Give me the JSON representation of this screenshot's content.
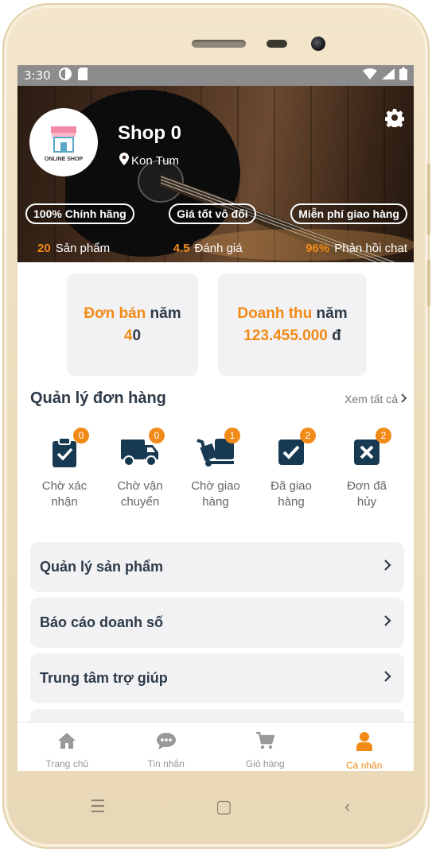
{
  "status_bar": {
    "time": "3:30"
  },
  "shop": {
    "name": "Shop 0",
    "location": "Kon Tum",
    "logo_text": "ONLINE SHOP",
    "badges": [
      "100% Chính hãng",
      "Giá tốt vô đối",
      "Miễn phí giao hàng"
    ],
    "stats": [
      {
        "value": "20",
        "label": "Sản phẩm"
      },
      {
        "value": "4.5",
        "label": "Đánh giá"
      },
      {
        "value": "96%",
        "label": "Phản hồi chat"
      }
    ]
  },
  "summary": {
    "orders_year": {
      "title_accent": "Đơn bán",
      "title_rest": " năm",
      "value_accent": "4",
      "value_rest": "0"
    },
    "revenue_year": {
      "title_accent": "Doanh thu",
      "title_rest": " năm",
      "value_accent": "123.455.000",
      "value_rest": " đ"
    }
  },
  "order_management": {
    "title": "Quản lý đơn hàng",
    "see_all": "Xem tất cả",
    "items": [
      {
        "label_1": "Chờ xác",
        "label_2": "nhận",
        "count": "0",
        "icon": "clipboard-check-icon"
      },
      {
        "label_1": "Chờ vận",
        "label_2": "chuyển",
        "count": "0",
        "icon": "truck-icon"
      },
      {
        "label_1": "Chờ giao",
        "label_2": "hàng",
        "count": "1",
        "icon": "dolly-icon"
      },
      {
        "label_1": "Đã giao",
        "label_2": "hàng",
        "count": "2",
        "icon": "check-square-icon"
      },
      {
        "label_1": "Đơn đã",
        "label_2": "hủy",
        "count": "2",
        "icon": "x-square-icon"
      }
    ]
  },
  "menu": {
    "items": [
      "Quản lý sản phẩm",
      "Báo cáo doanh số",
      "Trung tâm trợ giúp"
    ]
  },
  "tab_bar": {
    "tabs": [
      {
        "label": "Trang chủ",
        "icon": "home-icon"
      },
      {
        "label": "Tin nhắn",
        "icon": "chat-icon"
      },
      {
        "label": "Giỏ hàng",
        "icon": "cart-icon"
      },
      {
        "label": "Cá nhân",
        "icon": "user-icon"
      }
    ],
    "active": "Cá nhân"
  },
  "colors": {
    "accent": "#f28a17",
    "dark": "#2d3a48",
    "card_bg": "#f2f2f4"
  }
}
